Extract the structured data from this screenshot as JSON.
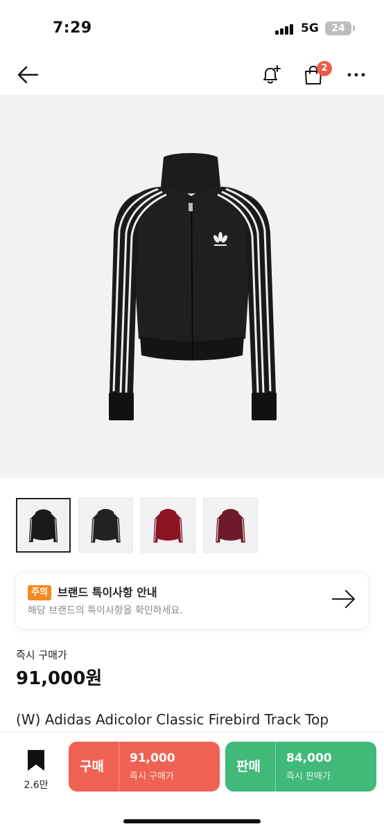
{
  "status_bar": {
    "time": "7:29",
    "network": "5G",
    "battery": "24"
  },
  "nav": {
    "back_icon": "arrow-left-icon",
    "alert_icon": "bell-plus-icon",
    "cart_icon": "shopping-bag-icon",
    "cart_badge": "2",
    "more_icon": "more-horizontal-icon"
  },
  "product": {
    "image_alt_icon": "track-jacket-image",
    "thumbnails": [
      {
        "color": "#1a1a1a",
        "selected": true
      },
      {
        "color": "#222222",
        "selected": false
      },
      {
        "color": "#8a1424",
        "selected": false
      },
      {
        "color": "#6e1a2a",
        "selected": false
      }
    ],
    "notice": {
      "tag": "주의",
      "title": "브랜드 특이사항 안내",
      "description": "해당 브랜드의 특이사항을 확인하세요."
    },
    "price_label": "즉시 구매가",
    "price": "91,000원",
    "name": "(W) Adidas Adicolor Classic Firebird Track Top"
  },
  "bottom_bar": {
    "wish_count": "2.6만",
    "buy": {
      "label": "구매",
      "price": "91,000",
      "sub": "즉시 구매가",
      "color": "#ef6253"
    },
    "sell": {
      "label": "판매",
      "price": "84,000",
      "sub": "즉시 판매가",
      "color": "#41b979"
    }
  }
}
